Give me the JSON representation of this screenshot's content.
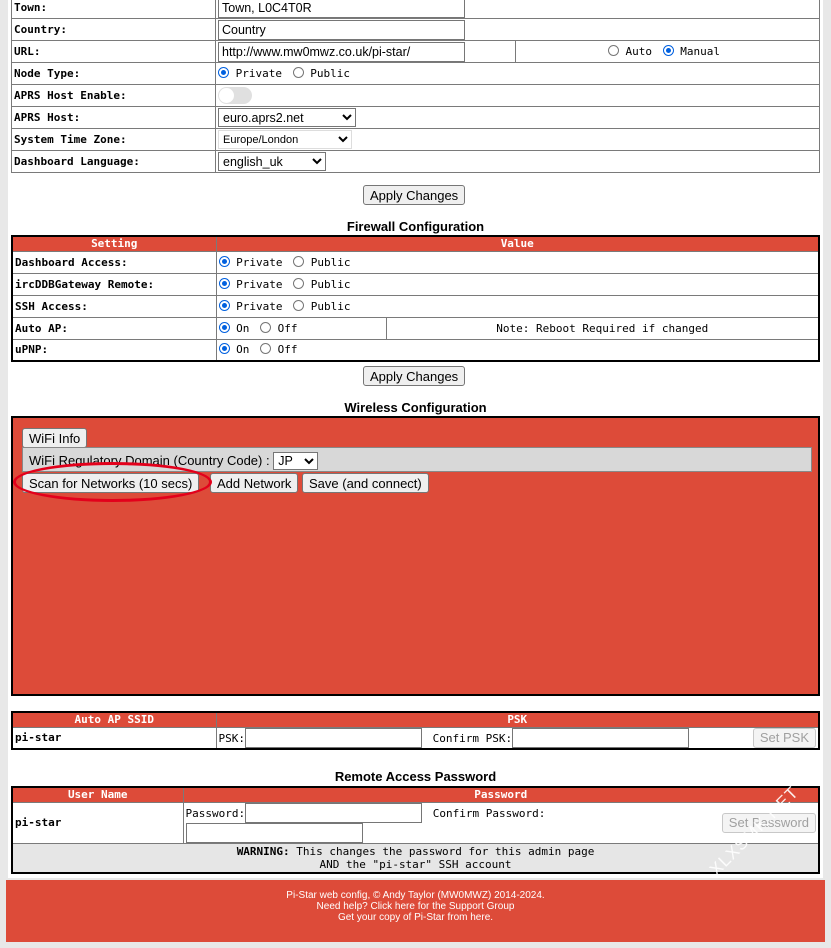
{
  "general": {
    "rows": [
      {
        "label": "Town:",
        "value": "Town, L0C4T0R"
      },
      {
        "label": "Country:",
        "value": "Country"
      },
      {
        "label": "URL:",
        "value": "http://www.mw0mwz.co.uk/pi-star/"
      },
      {
        "label": "Node Type:"
      },
      {
        "label": "APRS Host Enable:"
      },
      {
        "label": "APRS Host:",
        "value": "euro.aprs2.net"
      },
      {
        "label": "System Time Zone:",
        "value": "Europe/London"
      },
      {
        "label": "Dashboard Language:",
        "value": "english_uk"
      }
    ],
    "url_auto": "Auto",
    "url_manual": "Manual",
    "private": "Private",
    "public": "Public",
    "apply": "Apply Changes"
  },
  "firewall": {
    "title": "Firewall Configuration",
    "col_setting": "Setting",
    "col_value": "Value",
    "rows": [
      {
        "label": "Dashboard Access:",
        "opt1": "Private",
        "opt2": "Public"
      },
      {
        "label": "ircDDBGateway Remote:",
        "opt1": "Private",
        "opt2": "Public"
      },
      {
        "label": "SSH Access:",
        "opt1": "Private",
        "opt2": "Public"
      },
      {
        "label": "Auto AP:",
        "opt1": "On",
        "opt2": "Off"
      },
      {
        "label": "uPNP:",
        "opt1": "On",
        "opt2": "Off"
      }
    ],
    "note": "Note: Reboot Required if changed",
    "apply": "Apply Changes"
  },
  "wireless": {
    "title": "Wireless Configuration",
    "wifi_info": "WiFi Info",
    "domain_label": "WiFi Regulatory Domain (Country Code) :",
    "domain_value": "JP",
    "scan": "Scan for Networks (10 secs)",
    "add": "Add Network",
    "save": "Save (and connect)"
  },
  "autoap": {
    "col_ssid": "Auto AP SSID",
    "col_psk": "PSK",
    "ssid": "pi-star",
    "psk_label": "PSK:",
    "confirm_label": "Confirm PSK:",
    "set": "Set PSK"
  },
  "remote": {
    "title": "Remote Access Password",
    "col_user": "User Name",
    "col_pass": "Password",
    "user": "pi-star",
    "pass_label": "Password:",
    "confirm_label": "Confirm Password:",
    "set": "Set Password",
    "warning_bold": "WARNING:",
    "warning_1": "This changes the password for this admin page",
    "warning_2": "AND the \"pi-star\" SSH account"
  },
  "footer": {
    "line1": "Pi-Star web config, © Andy Taylor (MW0MWZ) 2014-2024.",
    "line2": "Need help? Click here for the Support Group",
    "line3": "Get your copy of Pi-Star from here."
  },
  "watermark": "XLXSMK.NET",
  "colors": {
    "accent": "#dd4b39",
    "radio": "#0060df",
    "highlight": "#e3001b"
  }
}
